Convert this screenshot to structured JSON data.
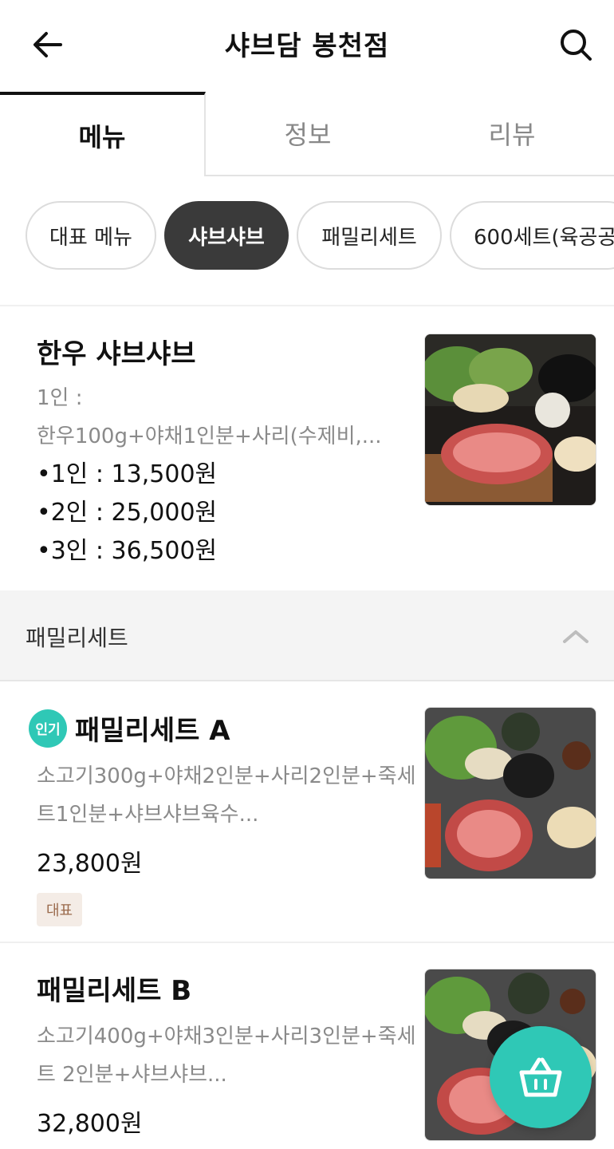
{
  "header": {
    "title": "샤브담 봉천점"
  },
  "tabs": [
    {
      "label": "메뉴",
      "active": true
    },
    {
      "label": "정보",
      "active": false
    },
    {
      "label": "리뷰",
      "active": false
    }
  ],
  "chips": [
    {
      "label": "대표 메뉴",
      "active": false
    },
    {
      "label": "샤브샤브",
      "active": true
    },
    {
      "label": "패밀리세트",
      "active": false
    },
    {
      "label": "600세트(육공공",
      "active": false
    }
  ],
  "items": [
    {
      "name": "한우 샤브샤브",
      "desc_line1": "1인 :",
      "desc_line2": "한우100g+야채1인분+사리(수제비,...",
      "prices": [
        "•1인 : 13,500원",
        "•2인 : 25,000원",
        "•3인 : 36,500원"
      ]
    },
    {
      "popular_badge": "인기",
      "name": "패밀리세트 A",
      "desc_line1": "소고기300g+야채2인분+사리2인분+죽세",
      "desc_line2": "트1인분+샤브샤브육수...",
      "price": "23,800원",
      "tag": "대표"
    },
    {
      "name": "패밀리세트 B",
      "desc_line1": "소고기400g+야채3인분+사리3인분+죽세",
      "desc_line2": "트 2인분+샤브샤브...",
      "price": "32,800원"
    }
  ],
  "section": {
    "title": "패밀리세트"
  },
  "icons": {
    "back": "arrow-left-icon",
    "search": "search-icon",
    "collapse": "chevron-up-icon",
    "cart": "basket-icon"
  },
  "colors": {
    "accent": "#2fc8b6",
    "chip_active": "#3a3a3a",
    "tag_bg": "#f4ece6",
    "tag_text": "#9a6a4c"
  }
}
